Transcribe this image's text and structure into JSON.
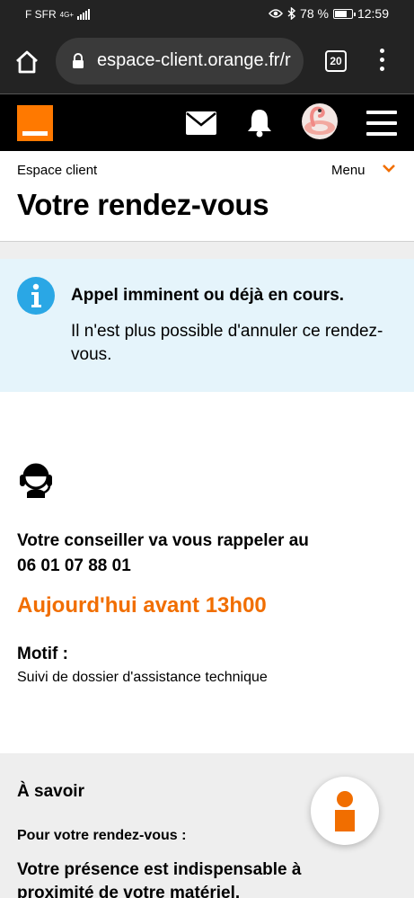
{
  "status_bar": {
    "carrier": "F SFR",
    "network": "4G+",
    "battery": "78 %",
    "battery_level": 0.78,
    "time": "12:59"
  },
  "browser": {
    "url": "espace-client.orange.fr/r",
    "tab_count": "20"
  },
  "breadcrumb": "Espace client",
  "menu_label": "Menu",
  "page_title": "Votre rendez-vous",
  "alert": {
    "title": "Appel imminent ou déjà en cours.",
    "text": "Il n'est plus possible d'annuler ce rendez-vous."
  },
  "appointment": {
    "callback_text": "Votre conseiller va vous rappeler au",
    "phone": "06 01 07 88 01",
    "when": "Aujourd'hui avant 13h00",
    "motif_label": "Motif :",
    "motif_value": "Suivi de dossier d'assistance technique"
  },
  "savoir": {
    "title": "À savoir",
    "subtitle": "Pour votre rendez-vous :",
    "text": "Votre présence est indispensable à proximité de votre matériel."
  },
  "colors": {
    "brand_orange": "#ff7900",
    "accent_orange": "#f16e00",
    "info_blue": "#2aa7e5",
    "alert_bg": "#e5f4fb"
  },
  "icons": [
    "home-icon",
    "lock-icon",
    "tabs-icon",
    "more-vert-icon",
    "mail-icon",
    "bell-icon",
    "hamburger-icon",
    "chevron-down-icon",
    "info-icon",
    "headset-icon",
    "chat-assistant-icon"
  ]
}
